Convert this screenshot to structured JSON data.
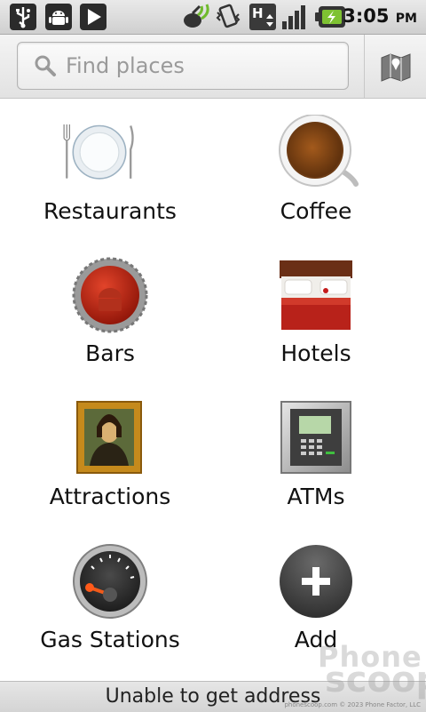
{
  "status_bar": {
    "time": "3:05",
    "ampm": "PM",
    "icons": [
      "usb-icon",
      "android-debug-icon",
      "play-store-icon",
      "gps-icon",
      "vibrate-icon",
      "hspa-signal-icon",
      "signal-bars-icon",
      "battery-charging-icon"
    ]
  },
  "search": {
    "placeholder": "Find places"
  },
  "categories": [
    {
      "label": "Restaurants",
      "icon": "plate-utensils-icon"
    },
    {
      "label": "Coffee",
      "icon": "coffee-cup-icon"
    },
    {
      "label": "Bars",
      "icon": "bottle-cap-icon"
    },
    {
      "label": "Hotels",
      "icon": "hotel-bed-icon"
    },
    {
      "label": "Attractions",
      "icon": "mona-lisa-painting-icon"
    },
    {
      "label": "ATMs",
      "icon": "atm-machine-icon"
    },
    {
      "label": "Gas Stations",
      "icon": "fuel-gauge-icon"
    },
    {
      "label": "Add",
      "icon": "add-plus-icon"
    }
  ],
  "footer": {
    "message": "Unable to get address"
  },
  "watermark": {
    "line1": "Phone",
    "line2": "scoop",
    "credit": "phonescoop.com   © 2023 Phone Factor, LLC"
  }
}
